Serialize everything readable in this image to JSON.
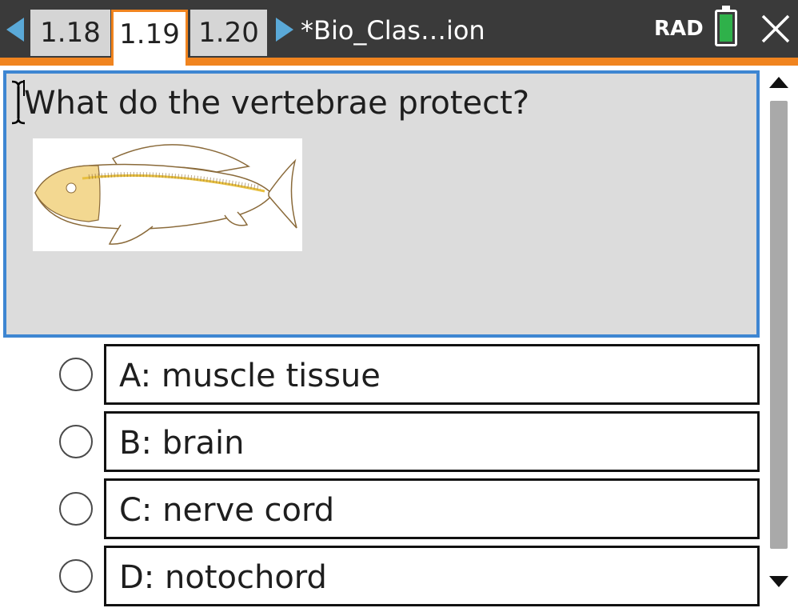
{
  "tabs": [
    {
      "label": "1.18",
      "active": false
    },
    {
      "label": "1.19",
      "active": true
    },
    {
      "label": "1.20",
      "active": false
    }
  ],
  "document_title": "*Bio_Clas…ion",
  "angle_mode": "RAD",
  "colors": {
    "accent": "#f0841f",
    "selection": "#3e86d2",
    "nav_arrow": "#5aa9d8",
    "battery": "#2fb14a"
  },
  "icons": {
    "prev": "triangle-left",
    "next": "triangle-right",
    "battery": "battery",
    "close": "x",
    "cursor": "text-cursor"
  },
  "question": {
    "text": "What do the vertebrae protect?",
    "image": "fish-skeleton"
  },
  "choices": [
    {
      "label": "A:  muscle tissue"
    },
    {
      "label": "B:  brain"
    },
    {
      "label": "C:  nerve cord"
    },
    {
      "label": "D:  notochord"
    }
  ]
}
